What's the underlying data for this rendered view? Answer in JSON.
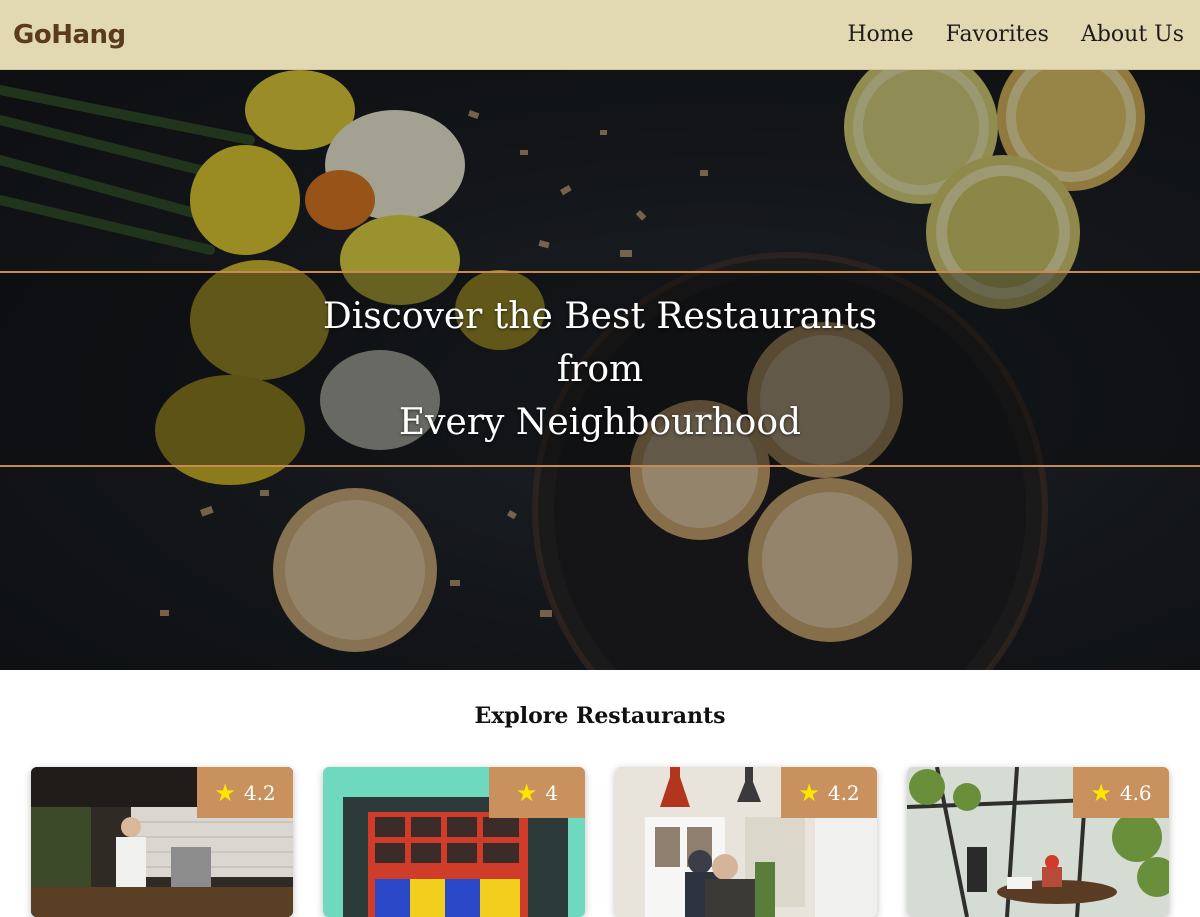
{
  "header": {
    "logo": "GoHang",
    "nav": [
      "Home",
      "Favorites",
      "About Us"
    ]
  },
  "hero": {
    "title_lines": [
      "Discover the Best Restaurants",
      "from",
      "Every Neighbourhood"
    ]
  },
  "explore": {
    "title": "Explore Restaurants",
    "restaurants": [
      {
        "rating": "4.2",
        "scene": "kitchen"
      },
      {
        "rating": "4",
        "scene": "storefront"
      },
      {
        "rating": "4.2",
        "scene": "cafe"
      },
      {
        "rating": "4.6",
        "scene": "greenhouse"
      }
    ]
  },
  "colors": {
    "header_bg": "#e2d9b2",
    "logo": "#5b3b1e",
    "accent": "#c98a52",
    "rating_bg": "#c8915d",
    "star": "#ffe600"
  },
  "icons": {
    "rating": "star-icon"
  }
}
